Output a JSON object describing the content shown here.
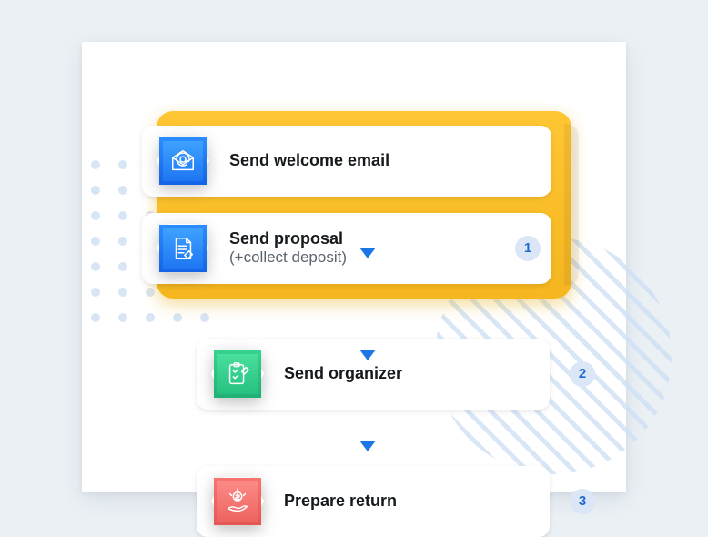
{
  "steps": [
    {
      "title": "Send welcome email",
      "sub": "",
      "color": "blue",
      "icon": "email-at-icon",
      "badge": ""
    },
    {
      "title": "Send proposal",
      "sub": "(+collect deposit)",
      "color": "blue",
      "icon": "document-sign-icon",
      "badge": "1"
    },
    {
      "title": "Send organizer",
      "sub": "",
      "color": "green",
      "icon": "checklist-icon",
      "badge": "2"
    },
    {
      "title": "Prepare return",
      "sub": "",
      "color": "red",
      "icon": "money-hand-icon",
      "badge": "3"
    }
  ],
  "colors": {
    "accent_yellow": "#f8bb22",
    "accent_blue": "#1e76f2",
    "accent_green": "#2ac084",
    "accent_red": "#ee6360",
    "badge_bg": "#dbe7f7",
    "badge_fg": "#1f6bd0"
  }
}
